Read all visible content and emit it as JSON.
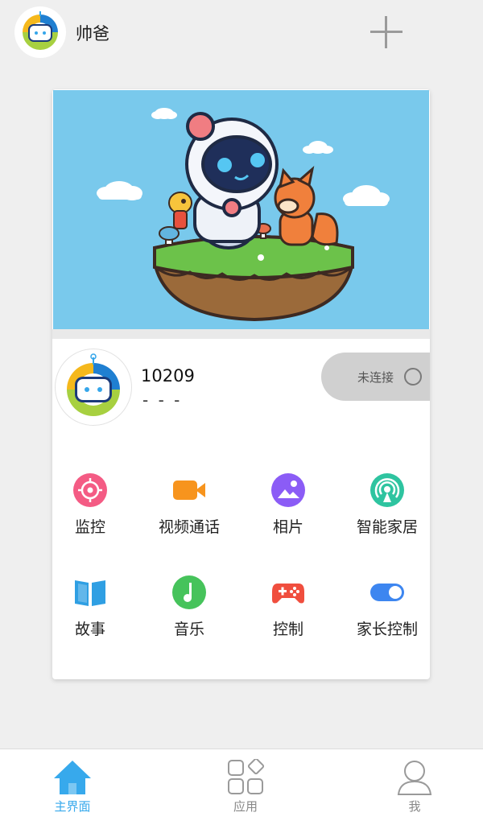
{
  "header": {
    "user_name": "帅爸",
    "add_icon": "plus-icon"
  },
  "device": {
    "id": "10209",
    "subtitle": "- - -",
    "status_label": "未连接",
    "status_icon": "circle-icon"
  },
  "features": [
    {
      "label": "监控",
      "icon": "target-icon",
      "color": "#f45b84"
    },
    {
      "label": "视频通话",
      "icon": "video-camera-icon",
      "color": "#f7941d"
    },
    {
      "label": "相片",
      "icon": "photo-icon",
      "color": "#8b5cf6"
    },
    {
      "label": "智能家居",
      "icon": "antenna-icon",
      "color": "#2ec4a0"
    },
    {
      "label": "故事",
      "icon": "book-icon",
      "color": "#2f9fe3"
    },
    {
      "label": "音乐",
      "icon": "music-note-icon",
      "color": "#46c35b"
    },
    {
      "label": "控制",
      "icon": "gamepad-icon",
      "color": "#f04e3e"
    },
    {
      "label": "家长控制",
      "icon": "toggle-icon",
      "color": "#3d86f0"
    }
  ],
  "tabbar": {
    "items": [
      {
        "label": "主界面",
        "icon": "home-icon",
        "active": true
      },
      {
        "label": "应用",
        "icon": "apps-icon",
        "active": false
      },
      {
        "label": "我",
        "icon": "person-icon",
        "active": false
      }
    ],
    "active_color": "#37a9ec"
  }
}
